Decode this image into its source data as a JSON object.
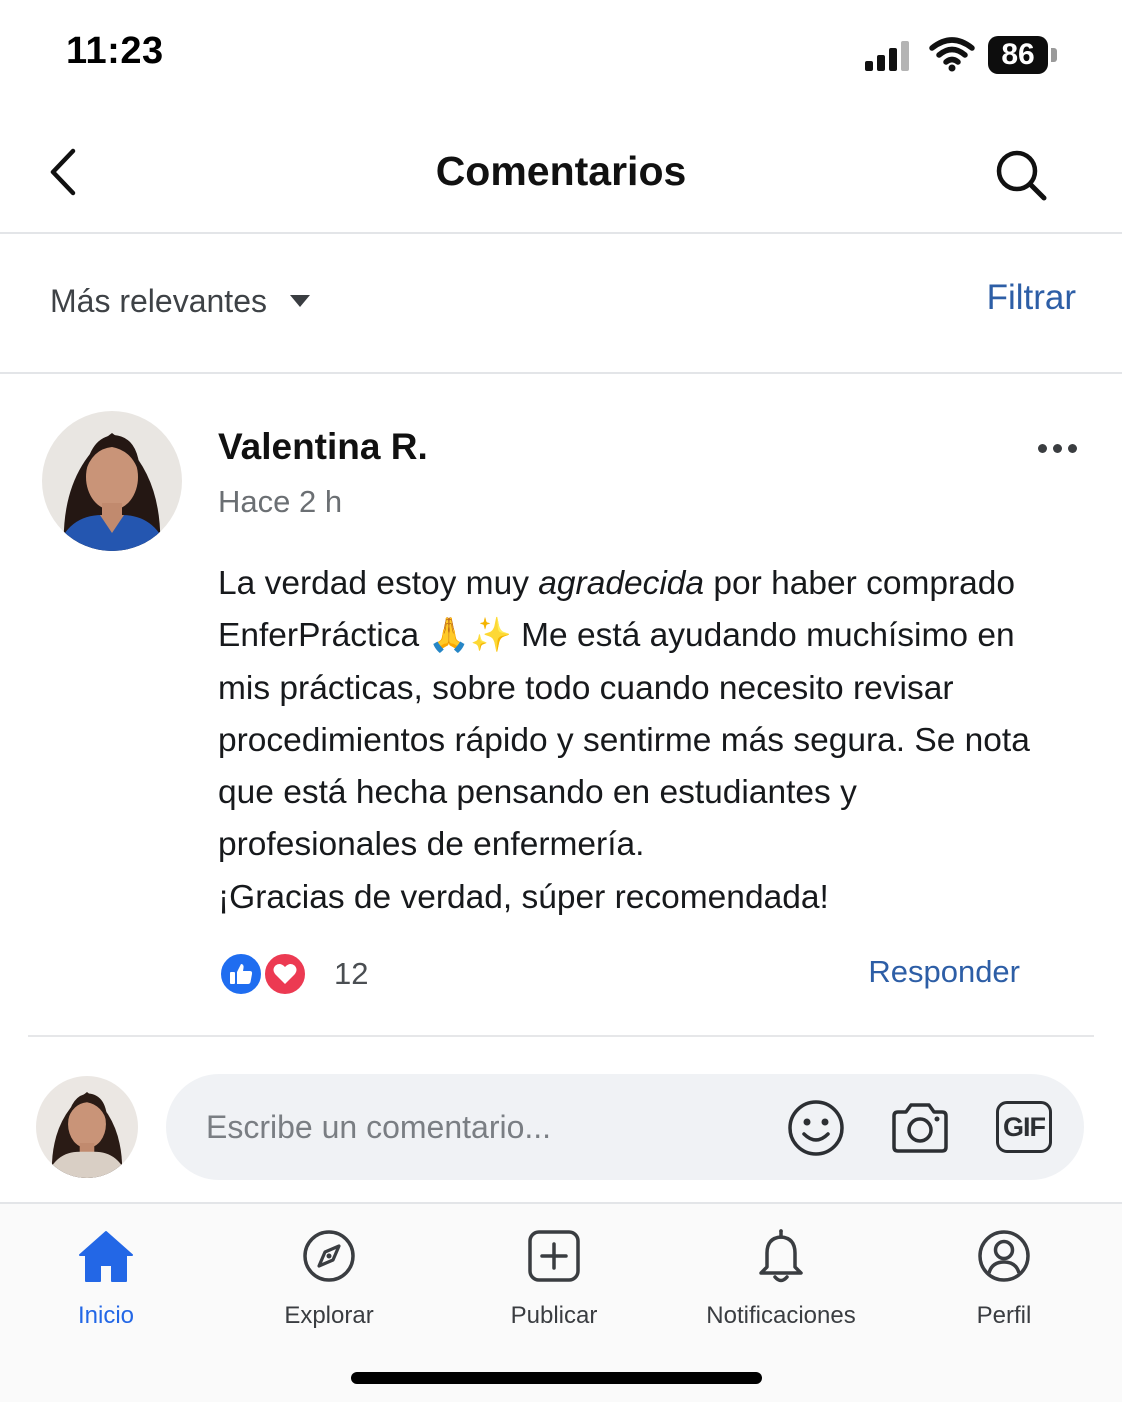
{
  "status_bar": {
    "time": "11:23",
    "battery": "86"
  },
  "header": {
    "title": "Comentarios",
    "back_icon": "chevron-left-icon",
    "search_icon": "search-icon"
  },
  "sort_bar": {
    "sort_label": "Más relevantes",
    "filter_label": "Filtrar"
  },
  "comment": {
    "author": "Valentina R.",
    "time": "Hace 2 h",
    "body": {
      "p1": "La verdad estoy muy ",
      "p2_italic": "agradecida",
      "p3": " por haber comprado EnferPráctica 🙏✨ Me está ayudando muchísimo en mis prácticas, sobre todo cuando necesito revisar procedimientos rápido y sentirme más segura. Se nota que está hecha pensando en estudiantes y profesionales de enfermería.",
      "p4": "¡Gracias de verdad, súper recomendada!"
    },
    "reaction_count": "12",
    "reply_label": "Responder"
  },
  "composer": {
    "placeholder": "Escribe un comentario...",
    "gif_label": "GIF"
  },
  "bottom_nav": [
    {
      "label": "Inicio",
      "icon": "home-icon",
      "active": true
    },
    {
      "label": "Explorar",
      "icon": "compass-icon",
      "active": false
    },
    {
      "label": "Publicar",
      "icon": "plus-square-icon",
      "active": false
    },
    {
      "label": "Notificaciones",
      "icon": "bell-icon",
      "active": false
    },
    {
      "label": "Perfil",
      "icon": "user-circle-icon",
      "active": false
    }
  ],
  "colors": {
    "accent": "#2367e6",
    "link": "#2d5ea6",
    "like": "#1f6df0",
    "love": "#ec3a52"
  }
}
